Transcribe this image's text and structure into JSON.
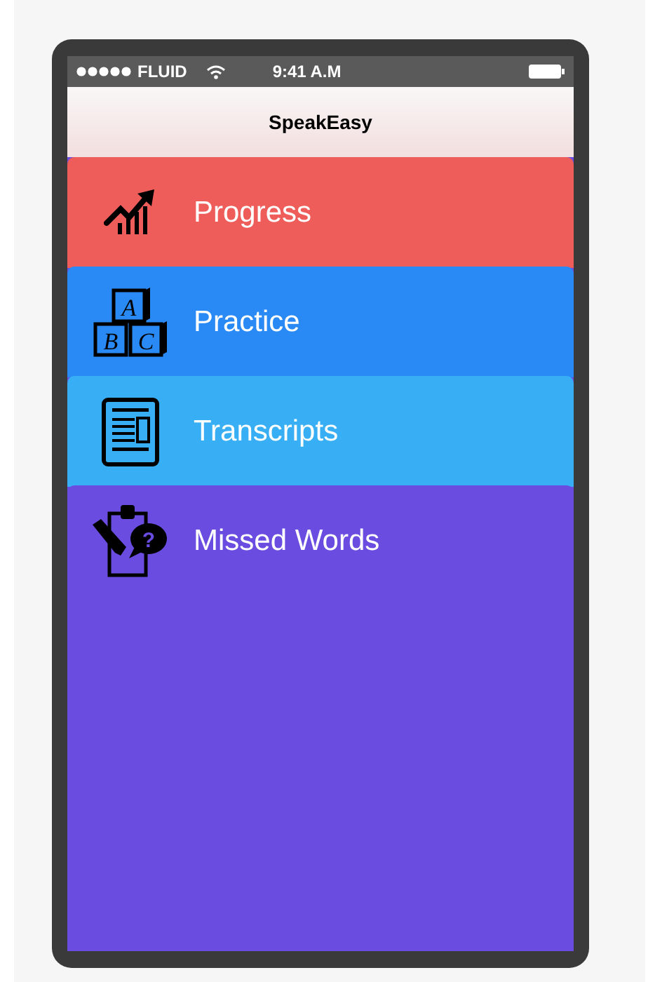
{
  "status_bar": {
    "carrier": "FLUID",
    "time": "9:41 A.M"
  },
  "header": {
    "title": "SpeakEasy"
  },
  "menu": [
    {
      "label": "Progress",
      "color": "#ef5d5a",
      "kind": "chart"
    },
    {
      "label": "Practice",
      "color": "#2a8af5",
      "kind": "blocks",
      "icon_letters": [
        "A",
        "B",
        "C"
      ]
    },
    {
      "label": "Transcripts",
      "color": "#38aff5",
      "kind": "document"
    },
    {
      "label": "Missed Words",
      "color": "#6a4ce0",
      "kind": "clipboard",
      "icon_letters": [
        "?"
      ]
    }
  ]
}
